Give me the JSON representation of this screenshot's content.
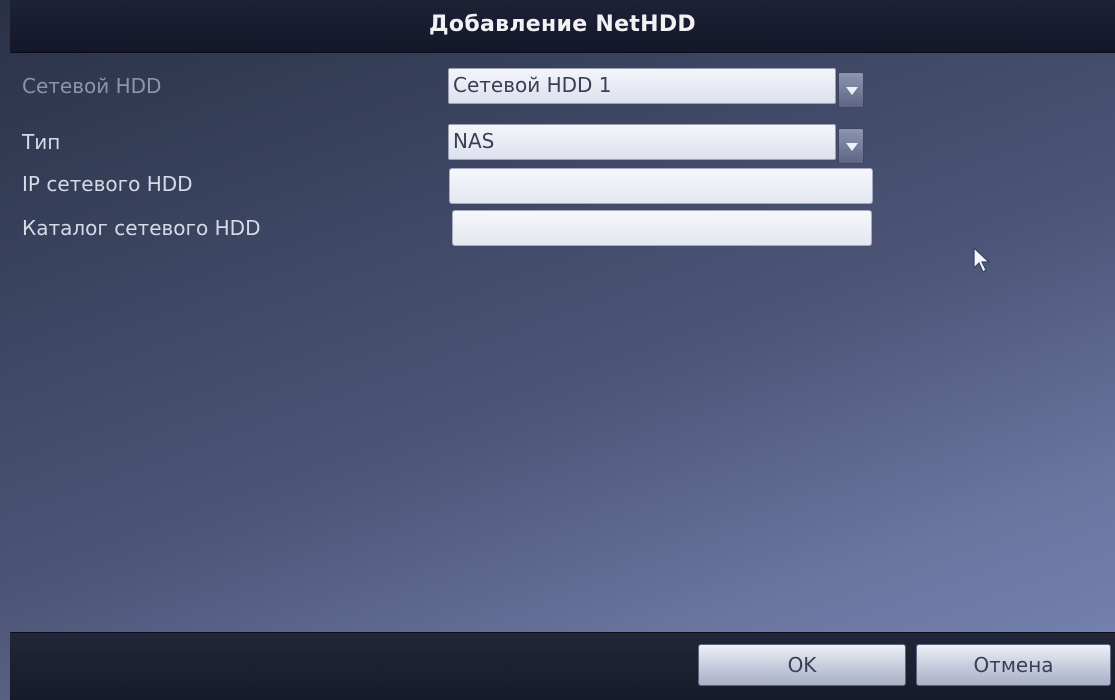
{
  "dialog": {
    "title": "Добавление NetHDD"
  },
  "form": {
    "network_hdd": {
      "label": "Сетевой HDD",
      "value": "Сетевой HDD 1"
    },
    "type": {
      "label": "Тип",
      "value": "NAS"
    },
    "ip": {
      "label": "IP сетевого HDD",
      "value": ""
    },
    "directory": {
      "label": "Каталог сетевого HDD",
      "value": ""
    }
  },
  "buttons": {
    "ok_label": "OK",
    "cancel_label": "Отмена"
  },
  "icons": {
    "dropdown": "chevron-down-icon",
    "pointer": "mouse-pointer-icon"
  }
}
